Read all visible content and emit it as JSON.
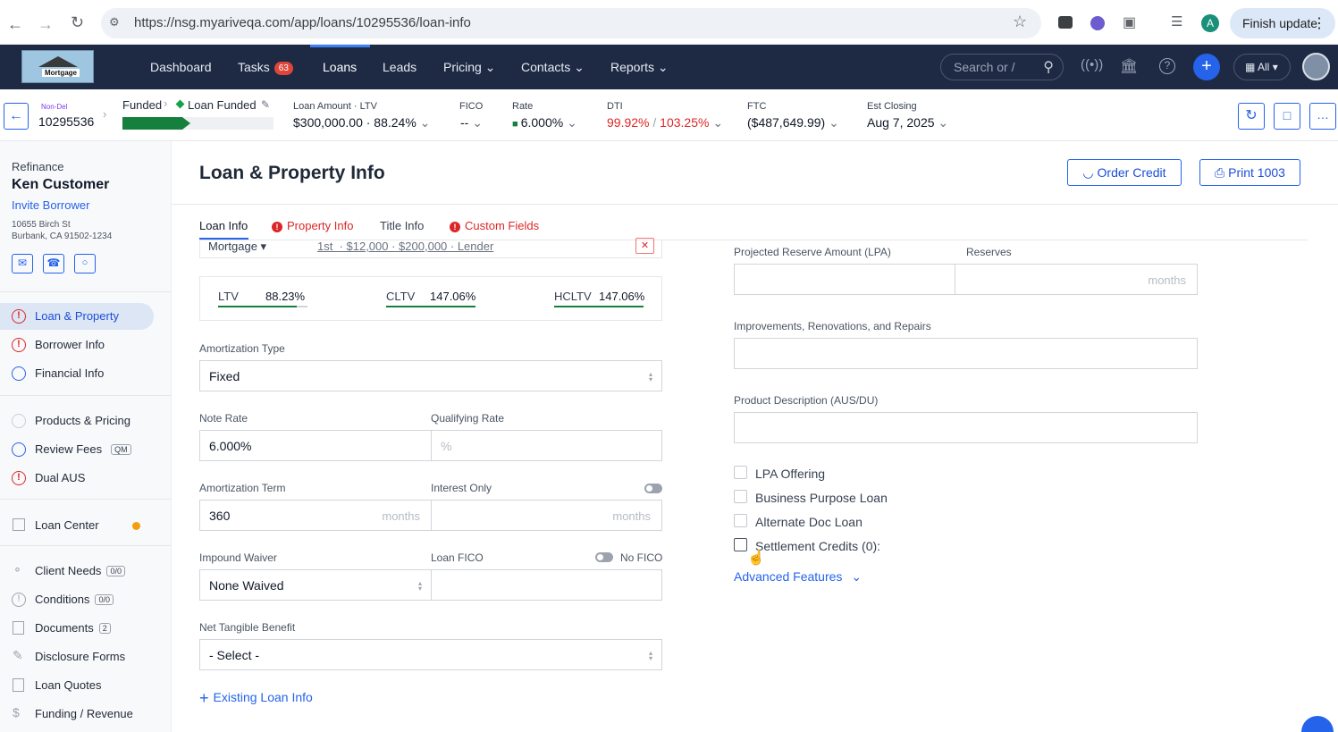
{
  "browser": {
    "url": "https://nsg.myariveqa.com/app/loans/10295536/loan-info",
    "finish_update": "Finish update",
    "avatar_letter": "A"
  },
  "nav": {
    "logo_text": "Mortgage",
    "items": [
      "Dashboard",
      "Tasks",
      "Loans",
      "Leads",
      "Pricing",
      "Contacts",
      "Reports"
    ],
    "tasks_count": "63",
    "search_placeholder": "Search or /",
    "all_label": "All"
  },
  "loan_header": {
    "non_del": "Non-Del",
    "loan_number": "10295536",
    "status_from": "Funded",
    "status_to": "Loan Funded",
    "loan_amount_label": "Loan Amount · LTV",
    "loan_amount_value": "$300,000.00 · 88.24%",
    "fico_label": "FICO",
    "fico_value": "--",
    "rate_label": "Rate",
    "rate_value": "6.000%",
    "dti_label": "DTI",
    "dti_front": "99.92%",
    "dti_sep": "/",
    "dti_back": "103.25%",
    "ftc_label": "FTC",
    "ftc_value": "($487,649.99)",
    "est_closing_label": "Est Closing",
    "est_closing_value": "Aug 7, 2025",
    "progress": 0.45
  },
  "sidebar": {
    "purpose": "Refinance",
    "borrower": "Ken Customer",
    "invite": "Invite Borrower",
    "addr1": "10655 Birch St",
    "addr2": "Burbank, CA 91502-1234",
    "items": [
      {
        "label": "Loan & Property",
        "state": "warn"
      },
      {
        "label": "Borrower Info",
        "state": "warn"
      },
      {
        "label": "Financial Info",
        "state": "check"
      },
      {
        "label": "Products & Pricing",
        "state": "empty"
      },
      {
        "label": "Review Fees",
        "state": "check",
        "tag": "QM"
      },
      {
        "label": "Dual AUS",
        "state": "warn"
      },
      {
        "label": "Loan Center"
      },
      {
        "label": "Client Needs",
        "count": "0/0"
      },
      {
        "label": "Conditions",
        "count": "0/0"
      },
      {
        "label": "Documents",
        "count": "2"
      },
      {
        "label": "Disclosure Forms"
      },
      {
        "label": "Loan Quotes"
      },
      {
        "label": "Funding / Revenue"
      }
    ]
  },
  "main": {
    "title": "Loan & Property Info",
    "order_credit": "Order Credit",
    "print_1003": "Print 1003",
    "tabs": [
      "Loan Info",
      "Property Info",
      "Title Info",
      "Custom Fields"
    ],
    "mortgage_select": "Mortgage",
    "lien_text": "1st  · $12,000 · $200,000 · Lender",
    "ltv": {
      "ltv_label": "LTV",
      "ltv": "88.23%",
      "cltv_label": "CLTV",
      "cltv": "147.06%",
      "hcltv_label": "HCLTV",
      "hcltv": "147.06%"
    },
    "amort_type_label": "Amortization Type",
    "amort_type": "Fixed",
    "note_rate_label": "Note Rate",
    "note_rate": "6.000%",
    "qual_rate_label": "Qualifying Rate",
    "qual_rate_placeholder": "%",
    "amort_term_label": "Amortization Term",
    "amort_term": "360",
    "months": "months",
    "interest_only_label": "Interest Only",
    "impound_label": "Impound Waiver",
    "impound": "None Waived",
    "loan_fico_label": "Loan FICO",
    "no_fico": "No FICO",
    "ntb_label": "Net Tangible Benefit",
    "ntb": "- Select -",
    "existing_loan": "Existing Loan Info",
    "reserve_label": "Projected Reserve Amount (LPA)",
    "reserves_label": "Reserves",
    "improvements_label": "Improvements, Renovations, and Repairs",
    "product_desc_label": "Product Description (AUS/DU)",
    "checkboxes": [
      "LPA Offering",
      "Business Purpose Loan",
      "Alternate Doc Loan",
      "Settlement Credits (0):"
    ],
    "advanced": "Advanced Features"
  }
}
